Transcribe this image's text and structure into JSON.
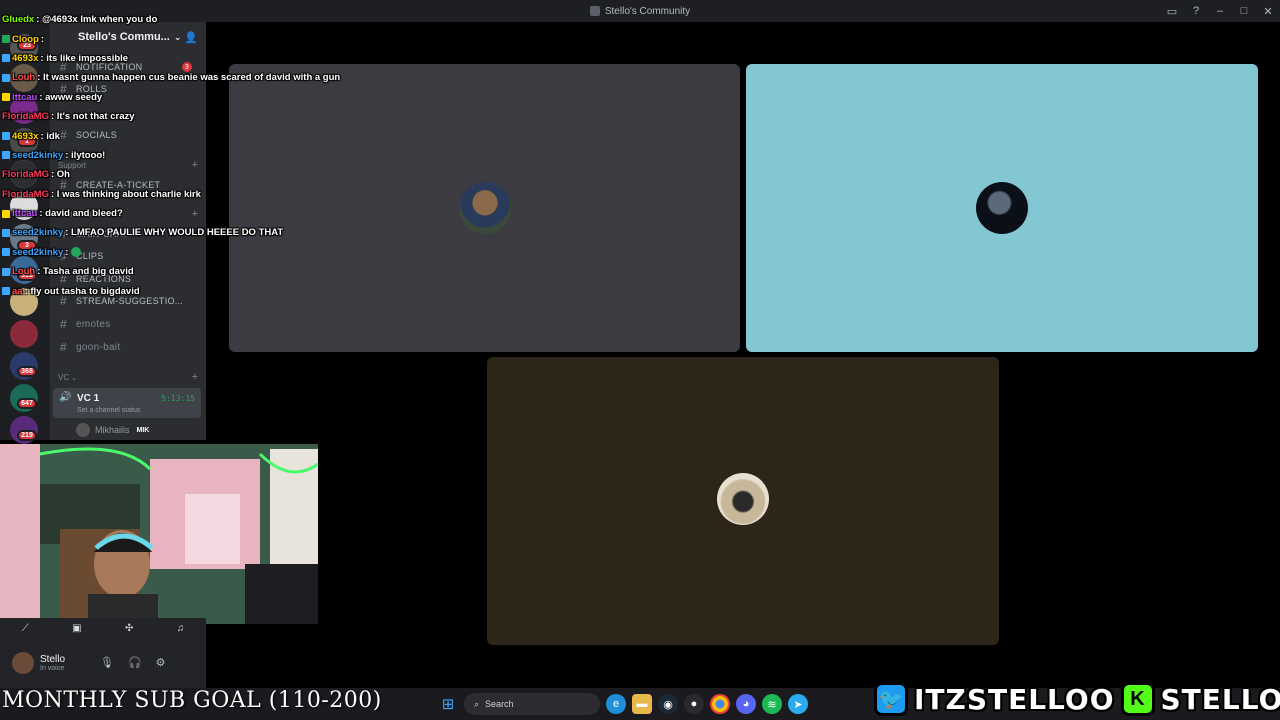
{
  "window": {
    "title": "Stello's Community"
  },
  "colors": {
    "tile1": "#3c3b41",
    "tile2": "#82c7d1",
    "tile3": "#2e2519",
    "twitter": "#1d9bf0",
    "kick": "#53fc18",
    "badge_red": "#da373c"
  },
  "server": {
    "name": "Stello's Commu...",
    "invite_icon": "add-user-icon"
  },
  "rail_badges": [
    "23",
    "1",
    "3",
    "313",
    "368",
    "647",
    "219"
  ],
  "channels": [
    {
      "label": "NOTIFICATION",
      "count": "3"
    },
    {
      "label": "ROLLS"
    },
    {
      "label": "SOCIALS"
    },
    {
      "label": "CREATE-A-TICKET"
    },
    {
      "label": "MAIN-CHAT"
    },
    {
      "label": "CLIPS"
    },
    {
      "label": "REACTIONS"
    },
    {
      "label": "STREAM-SUGGESTIO..."
    },
    {
      "label": "emotes"
    },
    {
      "label": "goon-bait"
    }
  ],
  "categories": {
    "support": "Support",
    "text": "Text Channels",
    "vc": "VC"
  },
  "voice_channel": {
    "name": "VC 1",
    "time": "5:13:15",
    "status": "Set a channel status",
    "member": "Mikhailis",
    "member_tag": "MIK"
  },
  "user_panel": {
    "name": "Stello",
    "status": "In voice"
  },
  "chat": [
    {
      "user": "Gluedx",
      "text": ": @4693x lmk when you do",
      "color": "#7fff00"
    },
    {
      "user": "Cloop",
      "text": ":",
      "color": "#ffd700"
    },
    {
      "user": "4693x",
      "text": ": its like impossible",
      "color": "#ffd700"
    },
    {
      "user": "Louh",
      "text": ": It wasnt gunna happen cus beanie was scared of david with a gun",
      "color": "#ff4d4d"
    },
    {
      "user": "ittcau",
      "text": ": awww seedy",
      "color": "#c04dff"
    },
    {
      "user": "FloridaMG",
      "text": ": It's not that crazy",
      "color": "#ff3b5c"
    },
    {
      "user": "4693x",
      "text": ": idk",
      "color": "#ffd700"
    },
    {
      "user": "seed2kinky",
      "text": ": ilytooo!",
      "color": "#3ba7ff"
    },
    {
      "user": "FloridaMG",
      "text": ": Oh",
      "color": "#ff3b5c"
    },
    {
      "user": "FloridaMG",
      "text": ": I was thinking about charlie kirk",
      "color": "#ff3b5c"
    },
    {
      "user": "ittcau",
      "text": ": david and bleed?",
      "color": "#c04dff"
    },
    {
      "user": "seed2kinky",
      "text": ": LMFAO PAULIE WHY WOULD HEEEE DO THAT",
      "color": "#3ba7ff"
    },
    {
      "user": "seed2kinky",
      "text": ":",
      "color": "#3ba7ff"
    },
    {
      "user": "Louh",
      "text": ": Tasha and big david",
      "color": "#ff4d4d"
    },
    {
      "user": "aa",
      "text": ": fly out tasha to bigdavid",
      "color": "#ff4d4d"
    }
  ],
  "overlay": {
    "goal": "MONTHLY SUB GOAL (110-200)",
    "twitter": "ITZSTELLOO",
    "kick": "STELLOOO",
    "kick_letter": "K"
  },
  "taskbar": {
    "search_placeholder": "Search"
  }
}
